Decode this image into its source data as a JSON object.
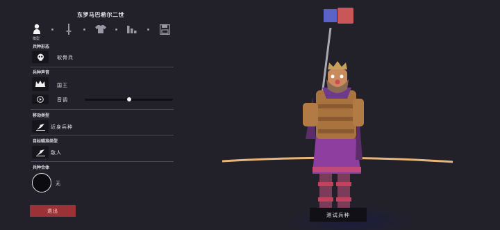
{
  "unit": {
    "name": "东罗马巴希尔二世"
  },
  "steps": [
    {
      "icon": "unit-model-icon",
      "label": "模型",
      "active": true
    },
    {
      "icon": "sword-icon",
      "label": "",
      "active": false
    },
    {
      "icon": "armor-icon",
      "label": "",
      "active": false
    },
    {
      "icon": "stats-icon",
      "label": "",
      "active": false
    },
    {
      "icon": "save-icon",
      "label": "",
      "active": false
    }
  ],
  "sections": {
    "form": {
      "label": "兵种形态",
      "value": "软骨兵",
      "icon": "skull-icon"
    },
    "voice": {
      "label": "兵种声音",
      "value": "国王",
      "icon": "crown-icon",
      "pitch_label": "音调",
      "pitch_icon": "play-icon",
      "pitch_level": 0.5
    },
    "movement": {
      "label": "移动类型",
      "value": "近身兵种",
      "icon": "melee-icon"
    },
    "targeting": {
      "label": "目标瞄准类型",
      "value": "敌人",
      "icon": "target-icon"
    },
    "combo": {
      "label": "兵种合体",
      "value": "无"
    }
  },
  "buttons": {
    "exit": "退出",
    "test": "测试兵种"
  },
  "colors": {
    "team_blue": "#5b63c9",
    "team_red": "#c95757",
    "exit_bg": "#9b3336",
    "panel_bg": "#22212a"
  }
}
